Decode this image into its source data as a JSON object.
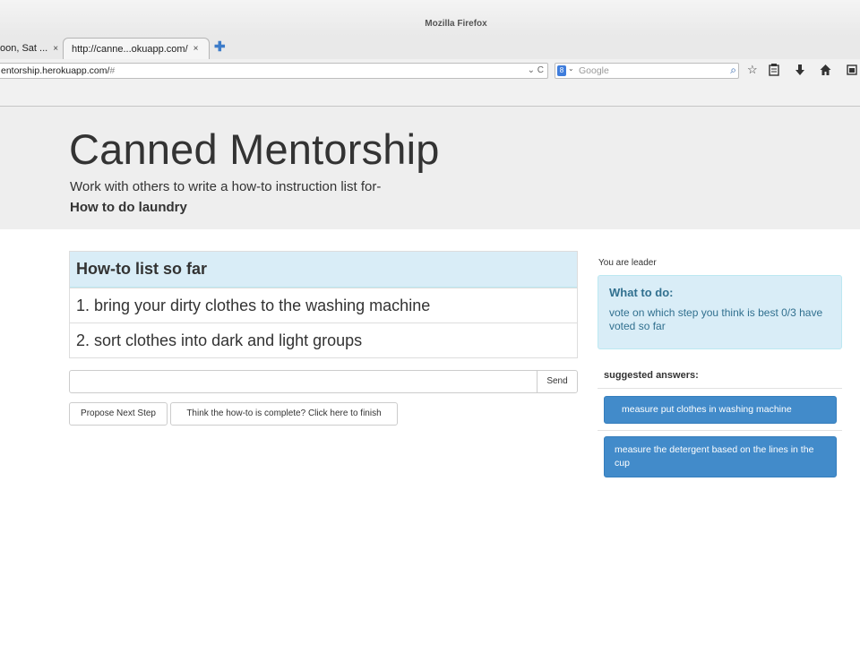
{
  "window": {
    "title": "Mozilla Firefox"
  },
  "tabs": [
    {
      "label": "oon, Sat ...",
      "close": "×"
    },
    {
      "label": "http://canne...okuapp.com/",
      "close": "×"
    }
  ],
  "new_tab_symbol": "✚",
  "urlbar": {
    "host": "entorship.herokuapp.com/",
    "fragment": "#",
    "dropdown": "⌄",
    "reload": "C"
  },
  "searchbar": {
    "engine": "8",
    "engine_arrow": "⌄",
    "placeholder": "Google",
    "mag": "⌕"
  },
  "toolbar_icons": [
    "star-icon",
    "reading-list-icon",
    "download-icon",
    "home-icon",
    "pocket-icon"
  ],
  "jumbotron": {
    "title": "Canned Mentorship",
    "intro": "Work with others to write a how-to instruction list for-",
    "topic": "How to do laundry"
  },
  "howto": {
    "heading": "How-to list so far",
    "steps": [
      "1. bring your dirty clothes to the washing machine",
      "2. sort clothes into dark and light groups"
    ]
  },
  "answer_input": {
    "value": "",
    "placeholder": ""
  },
  "buttons": {
    "send": "Send",
    "propose": "Propose Next Step",
    "finish": "Think the how-to is complete? Click here to finish"
  },
  "sidebar": {
    "leader_text": "You are leader",
    "alert_title": "What to do:",
    "alert_body": "vote on which step you think is best 0/3 have voted so far",
    "suggested_label": "suggested answers:",
    "suggested": [
      "measure put clothes in washing machine",
      "measure the detergent based on the lines in the cup"
    ]
  },
  "colors": {
    "primary": "#428bca",
    "info_bg": "#d9edf7",
    "info_text": "#31708f",
    "jumbotron_bg": "#eeeeee"
  }
}
